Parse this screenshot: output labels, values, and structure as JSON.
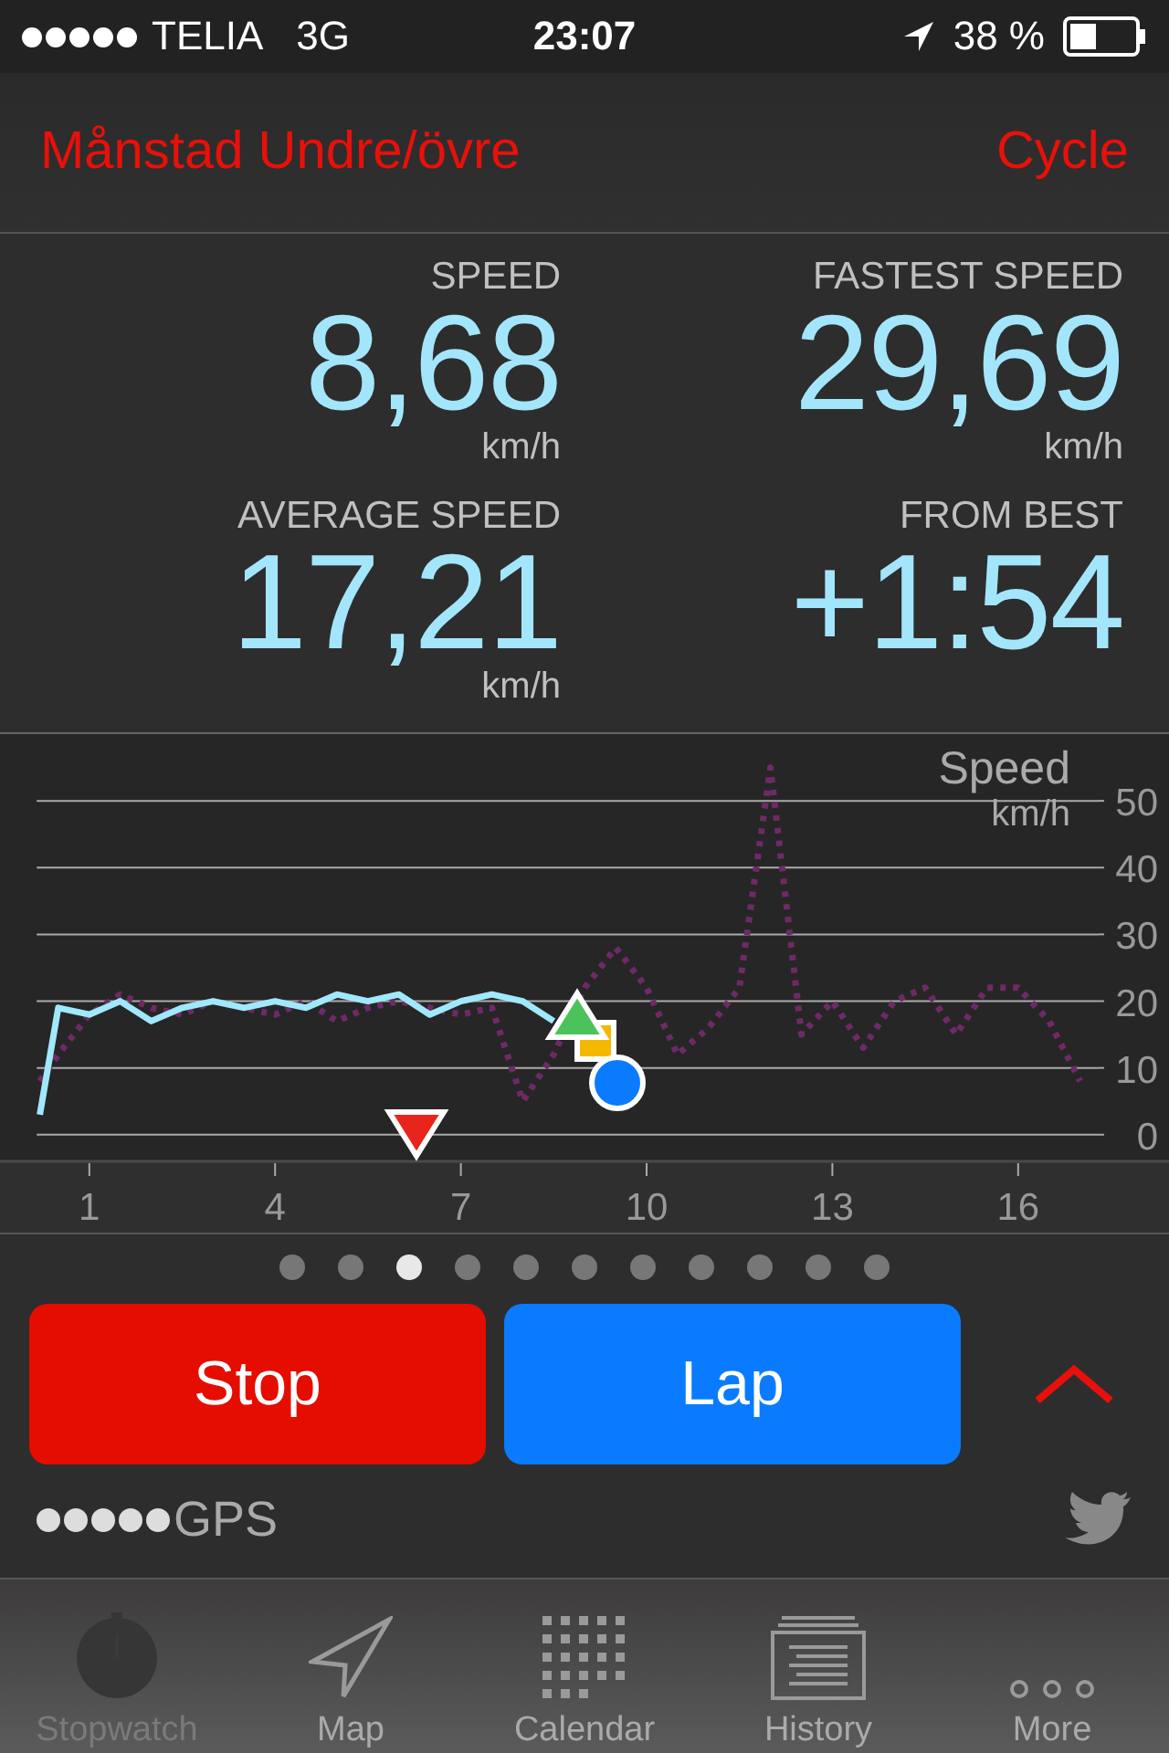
{
  "status_bar": {
    "carrier": "TELIA",
    "network": "3G",
    "time": "23:07",
    "battery": "38 %"
  },
  "header": {
    "title": "Månstad Undre/övre",
    "activity": "Cycle"
  },
  "stats": [
    {
      "label": "SPEED",
      "value": "8,68",
      "unit": "km/h"
    },
    {
      "label": "FASTEST SPEED",
      "value": "29,69",
      "unit": "km/h"
    },
    {
      "label": "AVERAGE SPEED",
      "value": "17,21",
      "unit": "km/h"
    },
    {
      "label": "FROM BEST",
      "value": "+1:54"
    }
  ],
  "chart": {
    "chart_data": {
      "type": "line",
      "title": "Speed",
      "ylabel": "km/h",
      "grid": true,
      "x": [
        0.2,
        0.5,
        1,
        1.5,
        2,
        2.5,
        3,
        3.5,
        4,
        4.5,
        5,
        5.5,
        6,
        6.5,
        7,
        7.5,
        8,
        8.5,
        9,
        9.5,
        10,
        10.5,
        11,
        11.5,
        12,
        12.5,
        13,
        13.5,
        14,
        14.5,
        15,
        15.5,
        16,
        16.5,
        17
      ],
      "series": [
        {
          "color": "#a0e8fc",
          "values": [
            3,
            19,
            18,
            20,
            17,
            19,
            20,
            19,
            20,
            19,
            21,
            20,
            21,
            18,
            20,
            21,
            20,
            17,
            null,
            null,
            null,
            null,
            null,
            null,
            null,
            null,
            null,
            null,
            null,
            null,
            null,
            null,
            null,
            null,
            null
          ]
        },
        {
          "color": "#6e2a66",
          "line_style": "dotted",
          "values": [
            8,
            12,
            18,
            21,
            19,
            18,
            20,
            19,
            18,
            20,
            17,
            19,
            20,
            19,
            18,
            19,
            5,
            12,
            22,
            28,
            22,
            12,
            16,
            22,
            55,
            15,
            20,
            13,
            20,
            22,
            15,
            22,
            22,
            17,
            8
          ]
        }
      ],
      "xlim": [
        0.15,
        17.3
      ],
      "ylim": [
        -4,
        60
      ],
      "xticks": [
        1,
        4,
        7,
        10,
        13,
        16
      ],
      "yticks": [
        0,
        10,
        20,
        30,
        40,
        50
      ]
    }
  },
  "pages": [
    {
      "selected": false
    },
    {
      "selected": false
    },
    {
      "selected": true
    },
    {
      "selected": false
    },
    {
      "selected": false
    },
    {
      "selected": false
    },
    {
      "selected": false
    },
    {
      "selected": false
    },
    {
      "selected": false
    },
    {
      "selected": false
    },
    {
      "selected": false
    }
  ],
  "buttons": [
    {
      "kind": "stop",
      "label": "Stop"
    },
    {
      "kind": "lap",
      "label": "Lap"
    }
  ],
  "gps": {
    "label": "GPS"
  },
  "tabs": [
    {
      "label": "Stopwatch",
      "kind": "stopwatch",
      "selected": true
    },
    {
      "label": "Map",
      "kind": "map",
      "selected": false
    },
    {
      "label": "Calendar",
      "kind": "calendar",
      "selected": false
    },
    {
      "label": "History",
      "kind": "history",
      "selected": false
    },
    {
      "label": "More",
      "kind": "more",
      "selected": false
    }
  ]
}
